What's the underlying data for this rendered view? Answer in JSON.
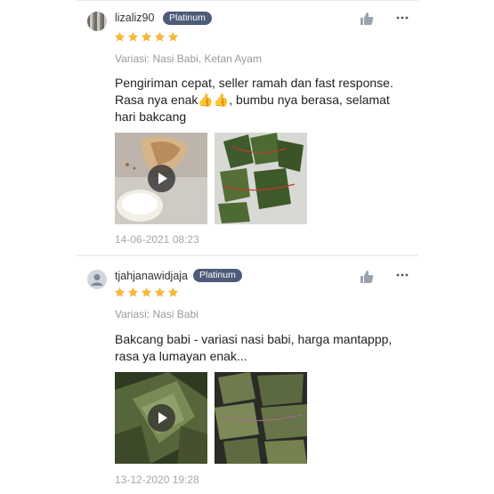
{
  "reviews": [
    {
      "username": "lizaliz90",
      "badge": "Platinum",
      "rating": 5,
      "variant": "Variasi: Nasi Babi, Ketan Ayam",
      "text": "Pengiriman cepat, seller ramah dan fast response. Rasa nya enak👍👍, bumbu nya berasa, selamat hari bakcang",
      "date": "14-06-2021 08:23"
    },
    {
      "username": "tjahjanawidjaja",
      "badge": "Platinum",
      "rating": 5,
      "variant": "Variasi: Nasi Babi",
      "text": "Bakcang babi - variasi nasi babi, harga mantappp, rasa ya lumayan enak...",
      "date": "13-12-2020 19:28"
    }
  ],
  "colors": {
    "star": "#f5b73b",
    "badge": "#4d5a78",
    "muted": "#9a9a9a",
    "icon": "#9aa3b0"
  },
  "icons": {
    "like": "thumbs-up-icon",
    "more": "more-dots-icon",
    "play": "play-icon",
    "star": "star-icon",
    "avatar_default": "user-icon"
  }
}
